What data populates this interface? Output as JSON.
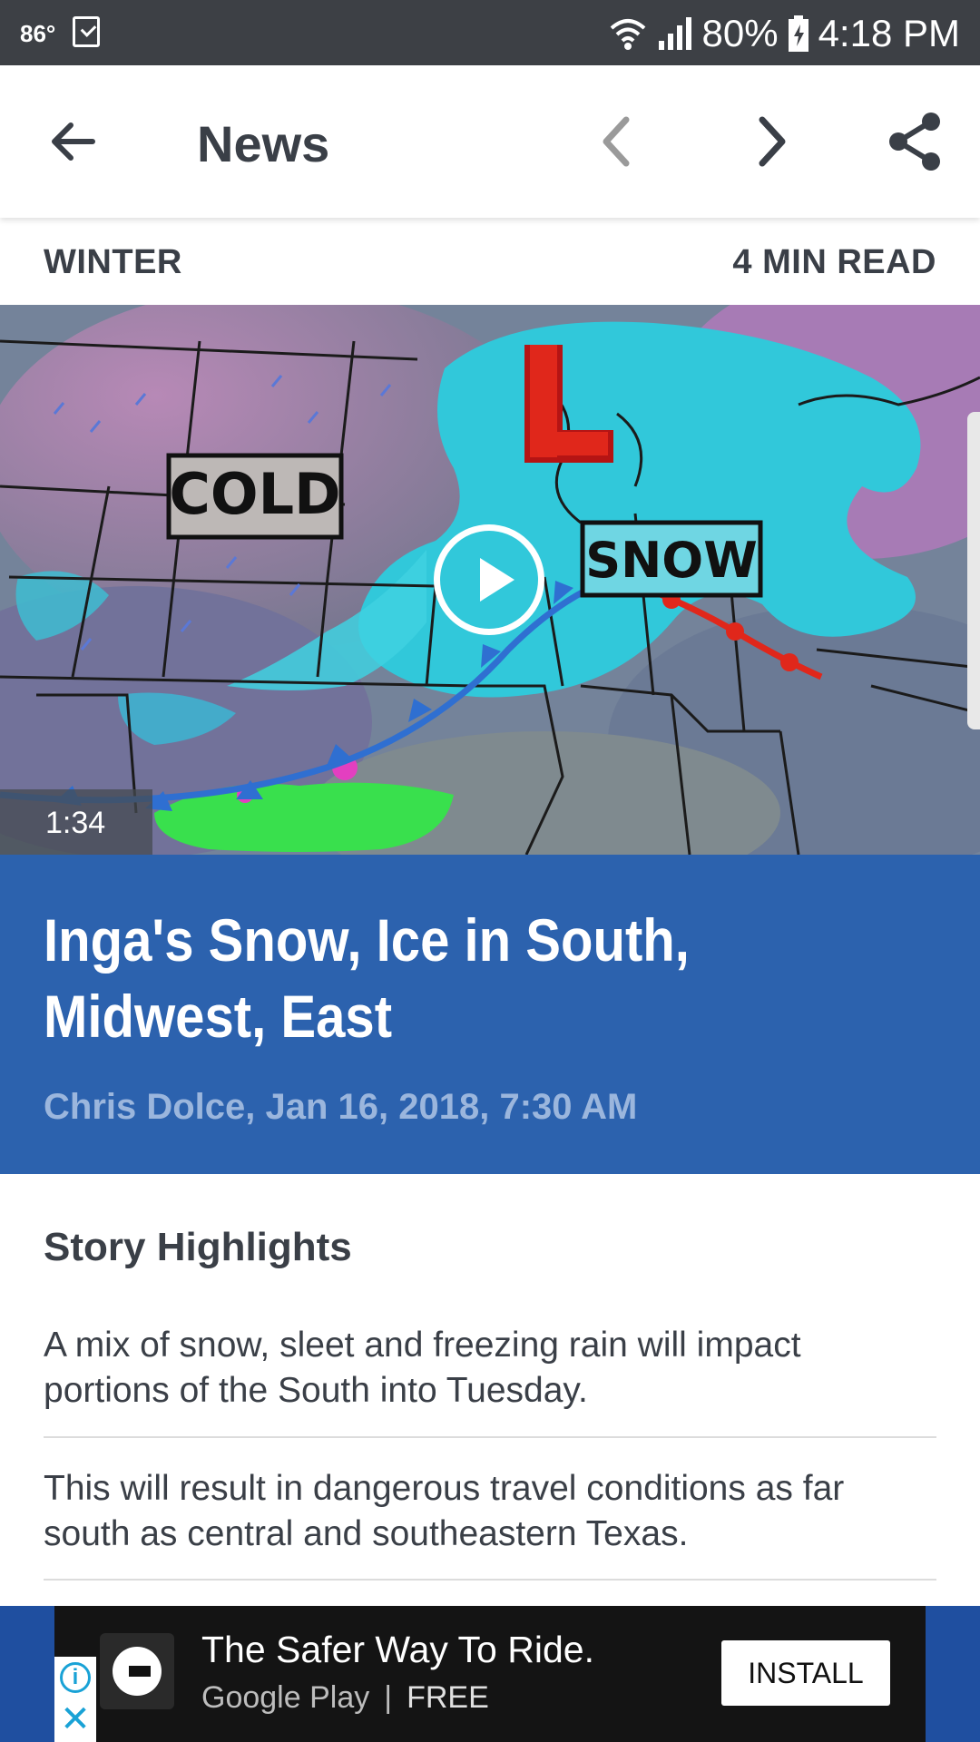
{
  "status_bar": {
    "temperature": "86°",
    "battery": "80%",
    "time": "4:18 PM",
    "icons": [
      "check-icon",
      "wifi-icon",
      "signal-icon",
      "battery-icon"
    ]
  },
  "app_bar": {
    "title": "News",
    "icons": [
      "back-arrow-icon",
      "chevron-left-icon",
      "chevron-right-icon",
      "share-icon"
    ]
  },
  "article": {
    "category": "WINTER",
    "read_time": "4 MIN READ",
    "video": {
      "duration": "1:34",
      "map_labels": {
        "cold": "COLD",
        "snow": "SNOW",
        "low": "L"
      }
    },
    "headline": "Inga's Snow, Ice in South, Midwest, East",
    "byline": "Chris Dolce, Jan 16, 2018, 7:30 AM",
    "highlights_title": "Story Highlights",
    "highlights": [
      "A mix of snow, sleet and freezing rain will impact portions of the South into Tuesday.",
      "This will result in dangerous travel conditions as far south as central and southeastern Texas."
    ]
  },
  "ad": {
    "headline": "The Safer Way To Ride.",
    "store": "Google Play",
    "separator": "|",
    "price": "FREE",
    "install_label": "INSTALL",
    "info_symbol": "i",
    "close_symbol": "✕"
  },
  "colors": {
    "status_bar": "#3d4045",
    "headline_bg": "#2c62ae",
    "text": "#3a3f47",
    "byline": "#9bb6dd"
  }
}
